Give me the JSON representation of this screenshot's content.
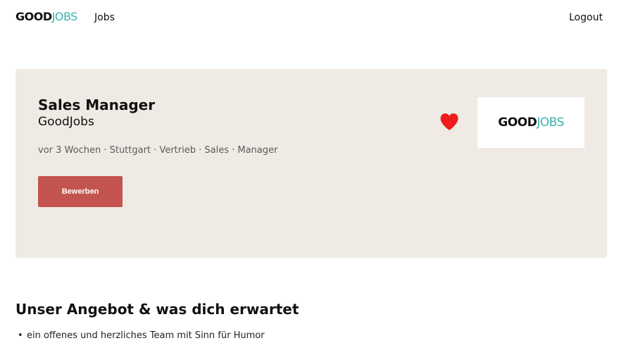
{
  "header": {
    "logo": {
      "part1": "GOOD",
      "part2": "JOBS"
    },
    "nav_jobs": "Jobs",
    "logout": "Logout"
  },
  "job": {
    "title": "Sales Manager",
    "company": "GoodJobs",
    "meta": "vor 3 Wochen · Stuttgart · Vertrieb · Sales · Manager",
    "apply_label": "Bewerben",
    "favorite_icon": "heart-icon",
    "company_logo": {
      "part1": "GOOD",
      "part2": "JOBS"
    }
  },
  "offer": {
    "title": "Unser Angebot & was dich erwartet",
    "items": [
      "ein offenes und herzliches Team mit Sinn für Humor"
    ]
  },
  "colors": {
    "brand_teal": "#3ab3ad",
    "apply_button": "#c4544f",
    "card_background": "#efebe4",
    "heart": "#ee1c1c"
  }
}
